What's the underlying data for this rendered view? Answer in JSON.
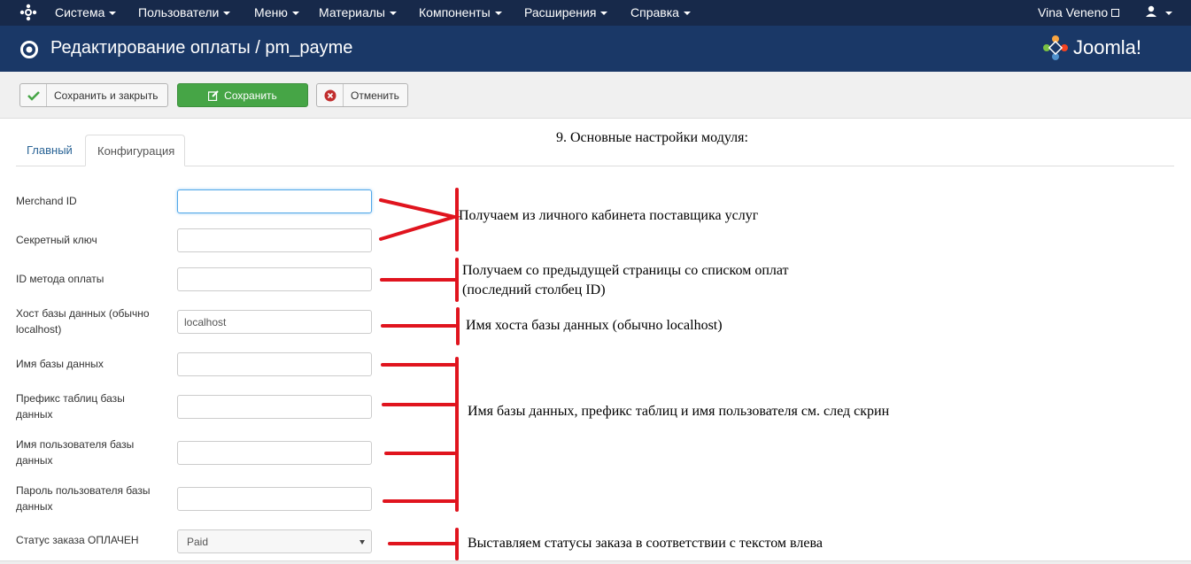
{
  "colors": {
    "navbar": "#17294a",
    "subhead": "#1a3867",
    "save_green": "#46a546",
    "annotation_red": "#e0141e",
    "link": "#2a6496"
  },
  "navbar": {
    "brand_icon": "joomla-icon",
    "menu": [
      {
        "label": "Система"
      },
      {
        "label": "Пользователи"
      },
      {
        "label": "Меню"
      },
      {
        "label": "Материалы"
      },
      {
        "label": "Компоненты"
      },
      {
        "label": "Расширения"
      },
      {
        "label": "Справка"
      }
    ],
    "site_name": "Vina Veneno",
    "user_icon": "user-icon"
  },
  "subhead": {
    "title": "Редактирование оплаты / pm_payme",
    "logo_text": "Joomla!"
  },
  "toolbar": {
    "save_close_label": "Сохранить и закрыть",
    "save_label": "Сохранить",
    "cancel_label": "Отменить"
  },
  "tabs": [
    {
      "label": "Главный",
      "active": false
    },
    {
      "label": "Конфигурация",
      "active": true
    }
  ],
  "section_heading": "9. Основные настройки модуля:",
  "form": {
    "fields": [
      {
        "label": "Merchand ID",
        "value": ""
      },
      {
        "label": "Секретный ключ",
        "value": ""
      },
      {
        "label": "ID метода оплаты",
        "value": ""
      },
      {
        "label": "Хост базы данных (обычно localhost)",
        "value": "localhost"
      },
      {
        "label": "Имя базы данных",
        "value": ""
      },
      {
        "label": "Префикс таблиц базы данных",
        "value": ""
      },
      {
        "label": "Имя пользователя базы данных",
        "value": ""
      },
      {
        "label": "Пароль пользователя базы данных",
        "value": ""
      },
      {
        "label": "Статус заказа ОПЛАЧЕН",
        "value": "Paid"
      }
    ]
  },
  "notes": {
    "n1": "Получаем из личного кабинета поставщика услуг",
    "n2_line1": "Получаем со предыдущей страницы со списком оплат",
    "n2_line2": "(последний столбец ID)",
    "n3": "Имя хоста базы данных (обычно localhost)",
    "n4": "Имя базы данных, префикс таблиц и имя пользователя см. след скрин",
    "n5": "Выставляем статусы заказа в соответствии с текстом влева"
  }
}
